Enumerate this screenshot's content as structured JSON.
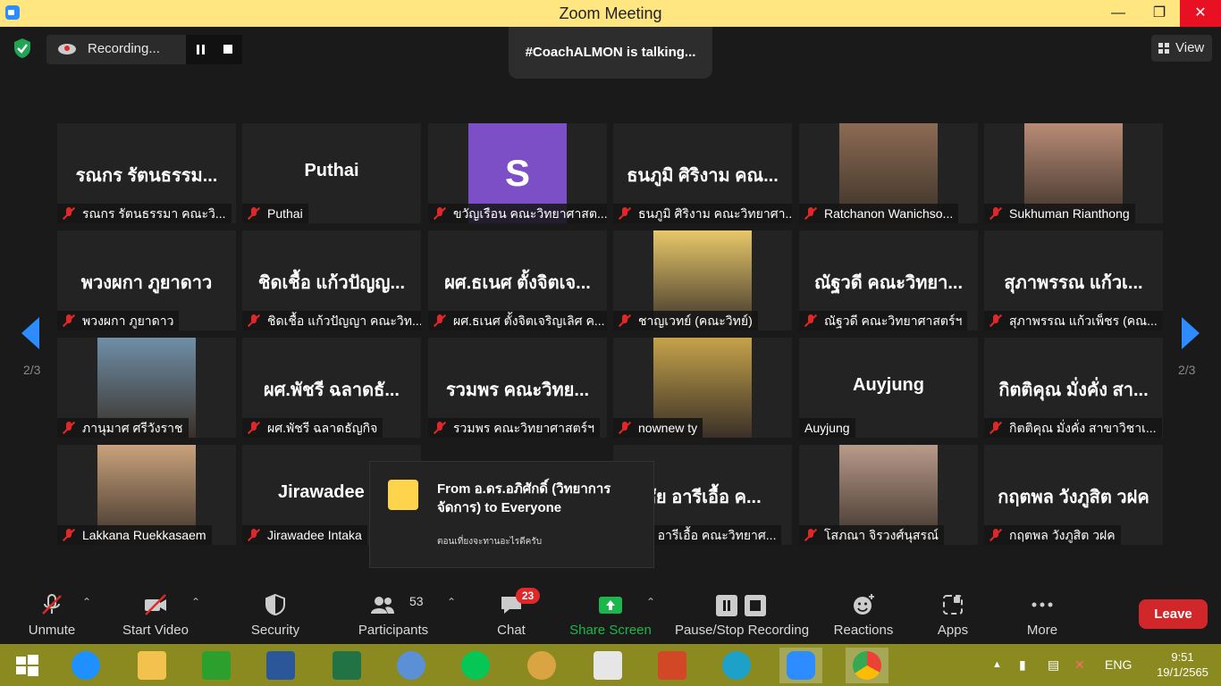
{
  "window": {
    "title": "Zoom Meeting"
  },
  "recording": {
    "label": "Recording..."
  },
  "talking": "#CoachALMON is talking...",
  "view": {
    "label": "View"
  },
  "pager": {
    "left": "2/3",
    "right": "2/3"
  },
  "tiles": [
    {
      "big": "รณกร รัตนธรรม...",
      "label": "รณกร รัตนธรรมา คณะวิ...",
      "muted": true
    },
    {
      "big": "Puthai",
      "label": "Puthai",
      "muted": true
    },
    {
      "big": "S",
      "label": "ขวัญเรือน คณะวิทยาศาสต...",
      "muted": true,
      "avatar_color": "#7c4fc7"
    },
    {
      "big": "ธนภูมิ ศิริงาม คณ...",
      "label": "ธนภูมิ ศิริงาม คณะวิทยาศา...",
      "muted": true
    },
    {
      "big": "",
      "label": "Ratchanon Wanichso...",
      "muted": true,
      "photo": true
    },
    {
      "big": "",
      "label": "Sukhuman Rianthong",
      "muted": true,
      "photo": true
    },
    {
      "big": "พวงผกา ภูยาดาว",
      "label": "พวงผกา ภูยาดาว",
      "muted": true
    },
    {
      "big": "ชิดเชื้อ แก้วปัญญ...",
      "label": "ชิดเชื้อ แก้วปัญญา คณะวิท...",
      "muted": true
    },
    {
      "big": "ผศ.ธเนศ ตั้งจิตเจ...",
      "label": "ผศ.ธเนศ ตั้งจิตเจริญเลิศ ค...",
      "muted": true
    },
    {
      "big": "",
      "label": "ชาญเวทย์ (คณะวิทย์)",
      "muted": true,
      "photo": true
    },
    {
      "big": "ณัฐวดี คณะวิทยา...",
      "label": "ณัฐวดี คณะวิทยาศาสตร์ฯ",
      "muted": true
    },
    {
      "big": "สุภาพรรณ แก้วเ...",
      "label": "สุภาพรรณ แก้วเพ็ชร (คณ...",
      "muted": true
    },
    {
      "big": "",
      "label": "ภานุมาศ ศรีวังราช",
      "muted": true,
      "photo": true
    },
    {
      "big": "ผศ.พัชรี ฉลาดธั...",
      "label": "ผศ.พัชรี ฉลาดธัญกิจ",
      "muted": true
    },
    {
      "big": "รวมพร คณะวิทย...",
      "label": "รวมพร คณะวิทยาศาสตร์ฯ",
      "muted": true
    },
    {
      "big": "",
      "label": "nownew ty",
      "muted": true,
      "photo": true
    },
    {
      "big": "Auyjung",
      "label": "Auyjung",
      "muted": false
    },
    {
      "big": "กิตติคุณ มั่งคั่ง สา...",
      "label": "กิตติคุณ มั่งคั่ง สาขาวิชาเ...",
      "muted": true
    },
    {
      "big": "",
      "label": "Lakkana Ruekkasaem",
      "muted": true,
      "photo": true
    },
    {
      "big": "Jirawadee In",
      "label": "Jirawadee Intaka",
      "muted": true
    },
    {
      "big": "",
      "label": "",
      "muted": false
    },
    {
      "big": "ชัย อารีเอื้อ ค...",
      "label": "ชัย อารีเอื้อ คณะวิทยาศ...",
      "muted": true
    },
    {
      "big": "",
      "label": "โสภณา จิรวงศ์นุสรณ์",
      "muted": true,
      "photo": true
    },
    {
      "big": "กฤตพล วังภูสิต วฝค",
      "label": "กฤตพล วังภูสิต วฝค",
      "muted": true
    }
  ],
  "chat_popup": {
    "from": "From อ.ดร.อภิศักดิ์ (วิทยาการจัดการ) to Everyone",
    "message": "ตอนเที่ยงจะทานอะไรดีครับ"
  },
  "toolbar": {
    "unmute": "Unmute",
    "start_video": "Start Video",
    "security": "Security",
    "participants": "Participants",
    "participants_count": "53",
    "chat": "Chat",
    "chat_badge": "23",
    "share_screen": "Share Screen",
    "pause_stop": "Pause/Stop Recording",
    "reactions": "Reactions",
    "apps": "Apps",
    "more": "More",
    "leave": "Leave"
  },
  "taskbar": {
    "language": "ENG",
    "time": "9:51",
    "date": "19/1/2565"
  },
  "colors": {
    "zoom_blue": "#2d8cff",
    "leave_red": "#d1272a",
    "share_green": "#1cb64d",
    "title_yellow": "#ffe680"
  }
}
